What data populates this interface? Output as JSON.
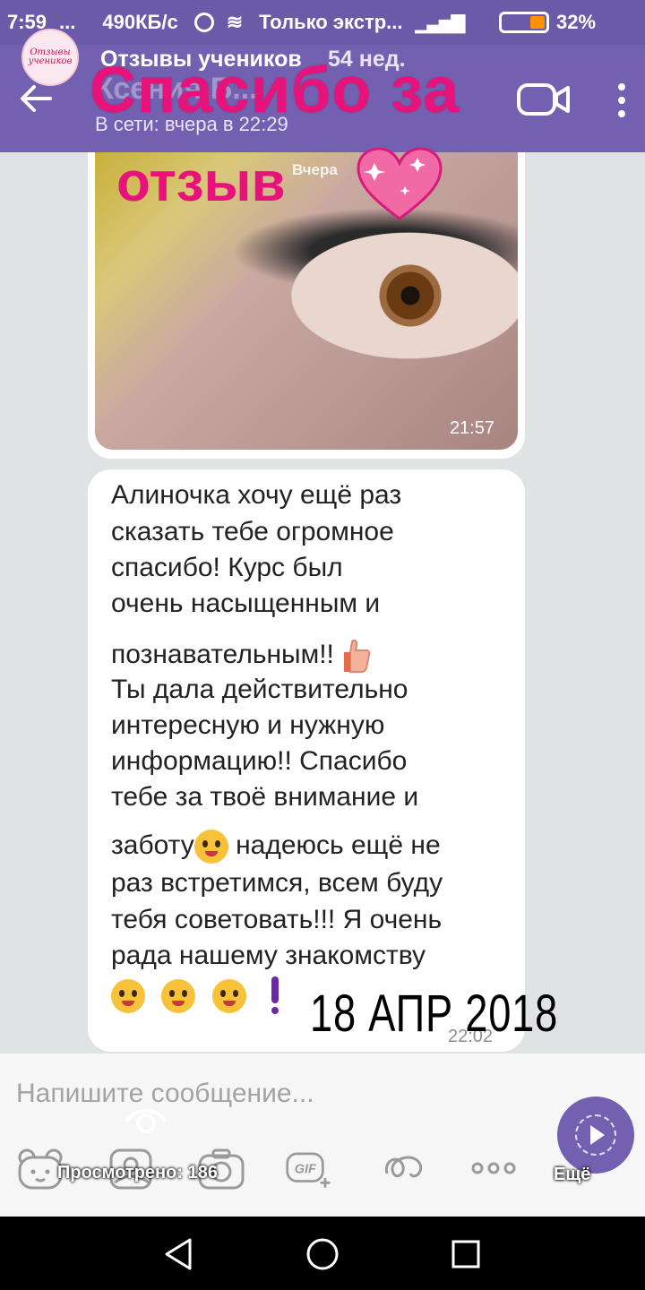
{
  "status_bar": {
    "time": "7:59",
    "dots": "...",
    "speed": "490КБ/с",
    "carrier": "Только экстр...",
    "battery": "32%"
  },
  "chat_header": {
    "contact_name": "Ксения Б...",
    "status": "В сети: вчера в 22:29"
  },
  "story": {
    "logo_text": "Отзывы учеников",
    "title": "Отзывы учеников",
    "age": "54 нед.",
    "sticker_line1": "Спасибо за",
    "sticker_line2": "отзыв",
    "views": "Просмотрено: 186",
    "more": "Ещё",
    "date_overlay": "18 АПР 2018 Г"
  },
  "photo_message": {
    "date_tag": "Вчера",
    "time": "21:57"
  },
  "text_message": {
    "lines": [
      "Алиночка хочу ещё раз",
      "сказать тебе огромное",
      "спасибо! Курс был",
      "очень насыщенным и",
      "познавательным!!",
      "Ты дала действительно",
      "интересную и нужную",
      "информацию!! Спасибо",
      "тебе за твоё внимание и",
      "заботу",
      "надеюсь ещё не",
      "раз встретимся, всем буду",
      "тебя советовать!!!  Я очень",
      "рада нашему знакомству"
    ],
    "time": "22:02"
  },
  "composer": {
    "placeholder": "Напишите сообщение..."
  },
  "icons": {
    "back": "arrow-left-icon",
    "video": "video-camera-icon",
    "menu": "more-vertical-icon",
    "sticker": "sticker-face-icon",
    "gallery": "gallery-icon",
    "camera": "camera-icon",
    "gif": "gif-icon",
    "doodle": "doodle-icon",
    "more": "more-horizontal-icon",
    "send": "send-icon"
  },
  "colors": {
    "header": "#7360b0",
    "accent_pink": "#e8137a",
    "bubble": "#ffffff",
    "chat_bg": "#dfe3e4"
  }
}
